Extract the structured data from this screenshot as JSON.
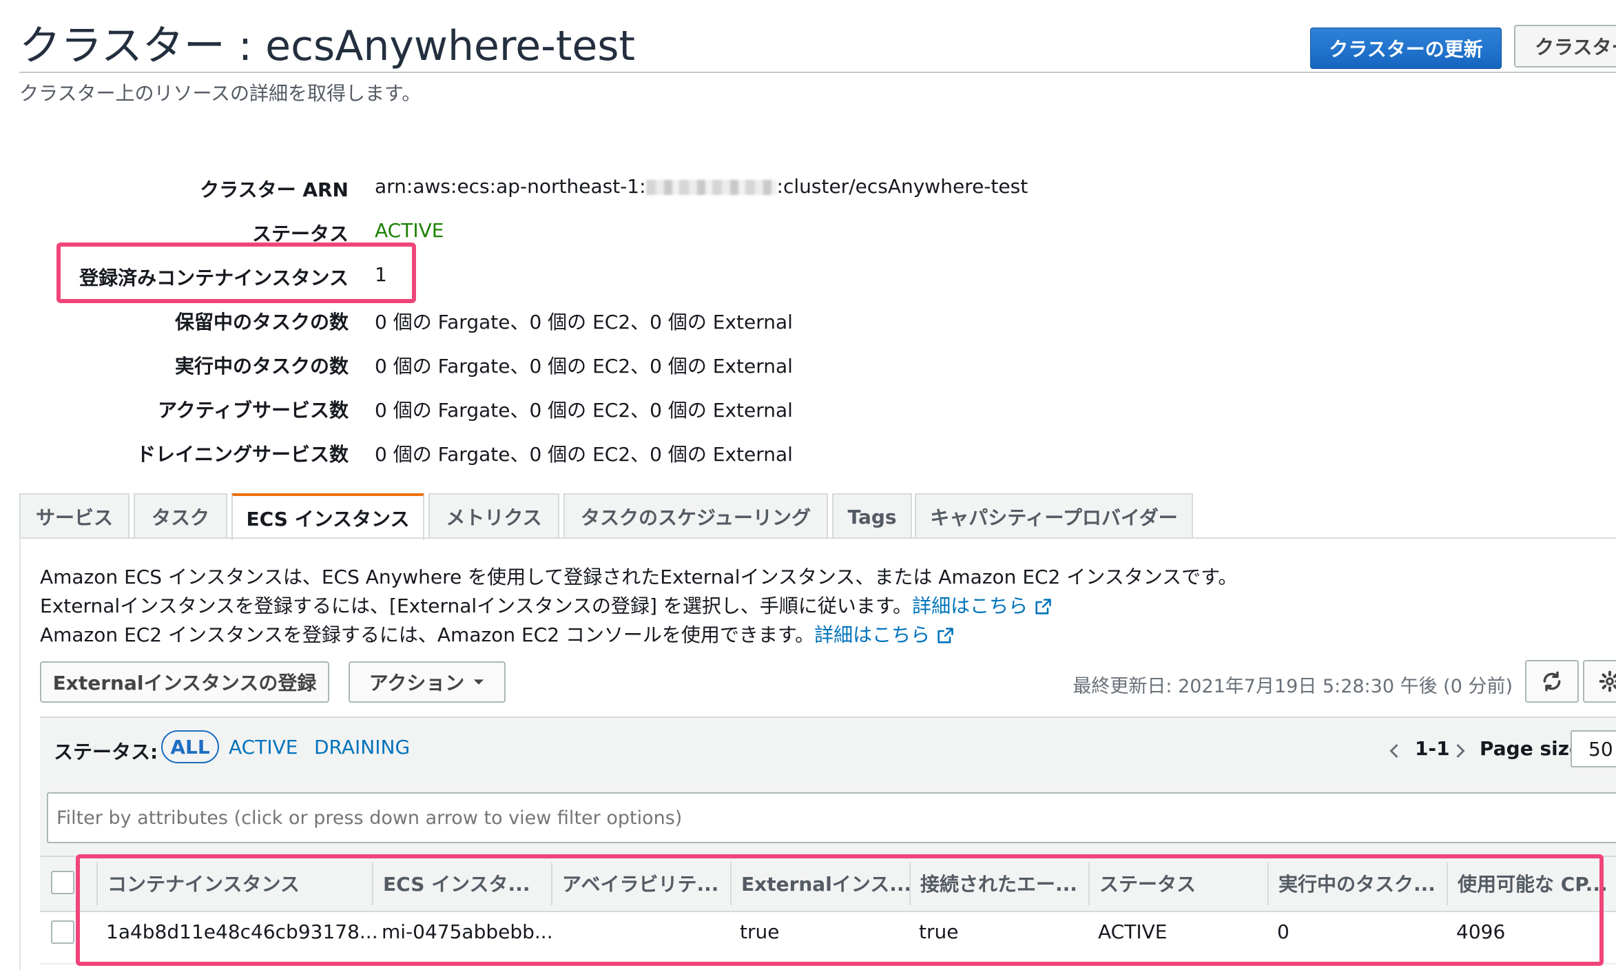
{
  "header": {
    "title": "クラスター : ecsAnywhere-test",
    "subtitle": "クラスター上のリソースの詳細を取得します。",
    "update_button": "クラスターの更新",
    "second_button": "クラスター"
  },
  "details": {
    "arn_label": "クラスター ARN",
    "arn_prefix": "arn:aws:ecs:ap-northeast-1:",
    "arn_suffix": ":cluster/ecsAnywhere-test",
    "status_label": "ステータス",
    "status_value": "ACTIVE",
    "registered_label": "登録済みコンテナインスタンス",
    "registered_value": "1",
    "pending_label": "保留中のタスクの数",
    "pending_value": "0 個の Fargate、0 個の EC2、0 個の External",
    "running_label": "実行中のタスクの数",
    "running_value": "0 個の Fargate、0 個の EC2、0 個の External",
    "active_services_label": "アクティブサービス数",
    "active_services_value": "0 個の Fargate、0 個の EC2、0 個の External",
    "draining_services_label": "ドレイニングサービス数",
    "draining_services_value": "0 個の Fargate、0 個の EC2、0 個の External"
  },
  "tabs": [
    "サービス",
    "タスク",
    "ECS インスタンス",
    "メトリクス",
    "タスクのスケジューリング",
    "Tags",
    "キャパシティープロバイダー"
  ],
  "active_tab": "ECS インスタンス",
  "description": {
    "line1": "Amazon ECS インスタンスは、ECS Anywhere を使用して登録されたExternalインスタンス、または Amazon EC2 インスタンスです。",
    "line2": "Externalインスタンスを登録するには、[Externalインスタンスの登録] を選択し、手順に従います。",
    "line2_link": "詳細はこちら",
    "line3": "Amazon EC2 インスタンスを登録するには、Amazon EC2 コンソールを使用できます。",
    "line3_link": "詳細はこちら"
  },
  "toolbar": {
    "register_button": "Externalインスタンスの登録",
    "actions_button": "アクション",
    "last_updated": "最終更新日: 2021年7月19日 5:28:30 午後 (0 分前)",
    "refresh_icon": "refresh-icon",
    "settings_icon": "gear-icon"
  },
  "filter": {
    "status_label": "ステータス:",
    "all": "ALL",
    "active": "ACTIVE",
    "draining": "DRAINING",
    "pagination": "1-1",
    "page_size_label": "Page size",
    "page_size_value": "50",
    "search_placeholder": "Filter by attributes (click or press down arrow to view filter options)"
  },
  "table": {
    "columns": [
      "コンテナインスタンス",
      "ECS インスタ...",
      "アベイラビリテ...",
      "Externalインス...",
      "接続されたエー...",
      "ステータス",
      "実行中のタスク...",
      "使用可能な CP..."
    ],
    "rows": [
      [
        "1a4b8d11e48c46cb93178...",
        "mi-0475abbebb...",
        "",
        "true",
        "true",
        "ACTIVE",
        "0",
        "4096"
      ]
    ]
  },
  "colors": {
    "highlight": "#f0457a",
    "primary_button": "#1666c1",
    "link": "#0073bb",
    "active_status": "#1d8102",
    "active_tab_accent": "#ec7211"
  }
}
